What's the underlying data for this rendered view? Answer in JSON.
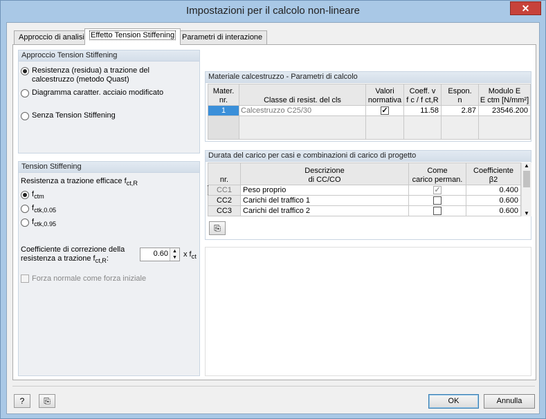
{
  "window": {
    "title": "Impostazioni per il calcolo non-lineare",
    "close_glyph": "✕"
  },
  "tabs": [
    {
      "label": "Approccio di analisi"
    },
    {
      "label": "Effetto Tension Stiffening"
    },
    {
      "label": "Parametri di interazione"
    }
  ],
  "approccio": {
    "title": "Approccio Tension Stiffening",
    "options": [
      {
        "label": "Resistenza (residua) a trazione del calcestruzzo (metodo Quast)",
        "selected": true
      },
      {
        "label": "Diagramma caratter. acciaio modificato",
        "selected": false
      },
      {
        "label": "Senza Tension Stiffening",
        "selected": false
      }
    ]
  },
  "tension": {
    "title": "Tension Stiffening",
    "resist_label": "Resistenza a trazione efficace f",
    "resist_sub": "ct,R",
    "options": [
      {
        "base": "f",
        "sub": "ctm",
        "selected": true
      },
      {
        "base": "f",
        "sub": "ctk,0.05",
        "selected": false
      },
      {
        "base": "f",
        "sub": "ctk,0.95",
        "selected": false
      }
    ],
    "coeff_label1": "Coefficiente di correzione della",
    "coeff_label2": "resistenza a trazione f",
    "coeff_sub": "ct,R",
    "coeff_colon": ":",
    "coeff_value": "0.60",
    "coeff_unit": "x f",
    "coeff_unit_sub": "ct",
    "forza_label": "Forza normale come forza iniziale"
  },
  "materiale": {
    "title": "Materiale calcestruzzo - Parametri di calcolo",
    "headers": {
      "nr1": "Mater.",
      "nr2": "nr.",
      "classe": "Classe di resist. del cls",
      "valori1": "Valori",
      "valori2": "normativa",
      "coeff1": "Coeff. v",
      "coeff2": "f c / f ct,R",
      "espon1": "Espon.",
      "espon2": "n",
      "modulo1": "Modulo E",
      "modulo2": "E ctm [N/mm²]"
    },
    "rows": [
      {
        "nr": "1",
        "classe": "Calcestruzzo C25/30",
        "valori": true,
        "coeff": "11.58",
        "espon": "2.87",
        "modulo": "23546.200"
      }
    ]
  },
  "durata": {
    "title": "Durata del carico per casi e combinazioni di carico di progetto",
    "headers": {
      "nr": "nr.",
      "desc1": "Descrizione",
      "desc2": "di CC/CO",
      "come1": "Come",
      "come2": "carico perman.",
      "coef1": "Coefficiente",
      "coef2": "β2"
    },
    "rows": [
      {
        "nr": "CC1",
        "desc": "Peso proprio",
        "checked": true,
        "coef": "0.400"
      },
      {
        "nr": "CC2",
        "desc": "Carichi del traffico 1",
        "checked": false,
        "coef": "0.600"
      },
      {
        "nr": "CC3",
        "desc": "Carichi del traffico 2",
        "checked": false,
        "coef": "0.600"
      }
    ]
  },
  "buttons": {
    "ok": "OK",
    "cancel": "Annulla"
  }
}
